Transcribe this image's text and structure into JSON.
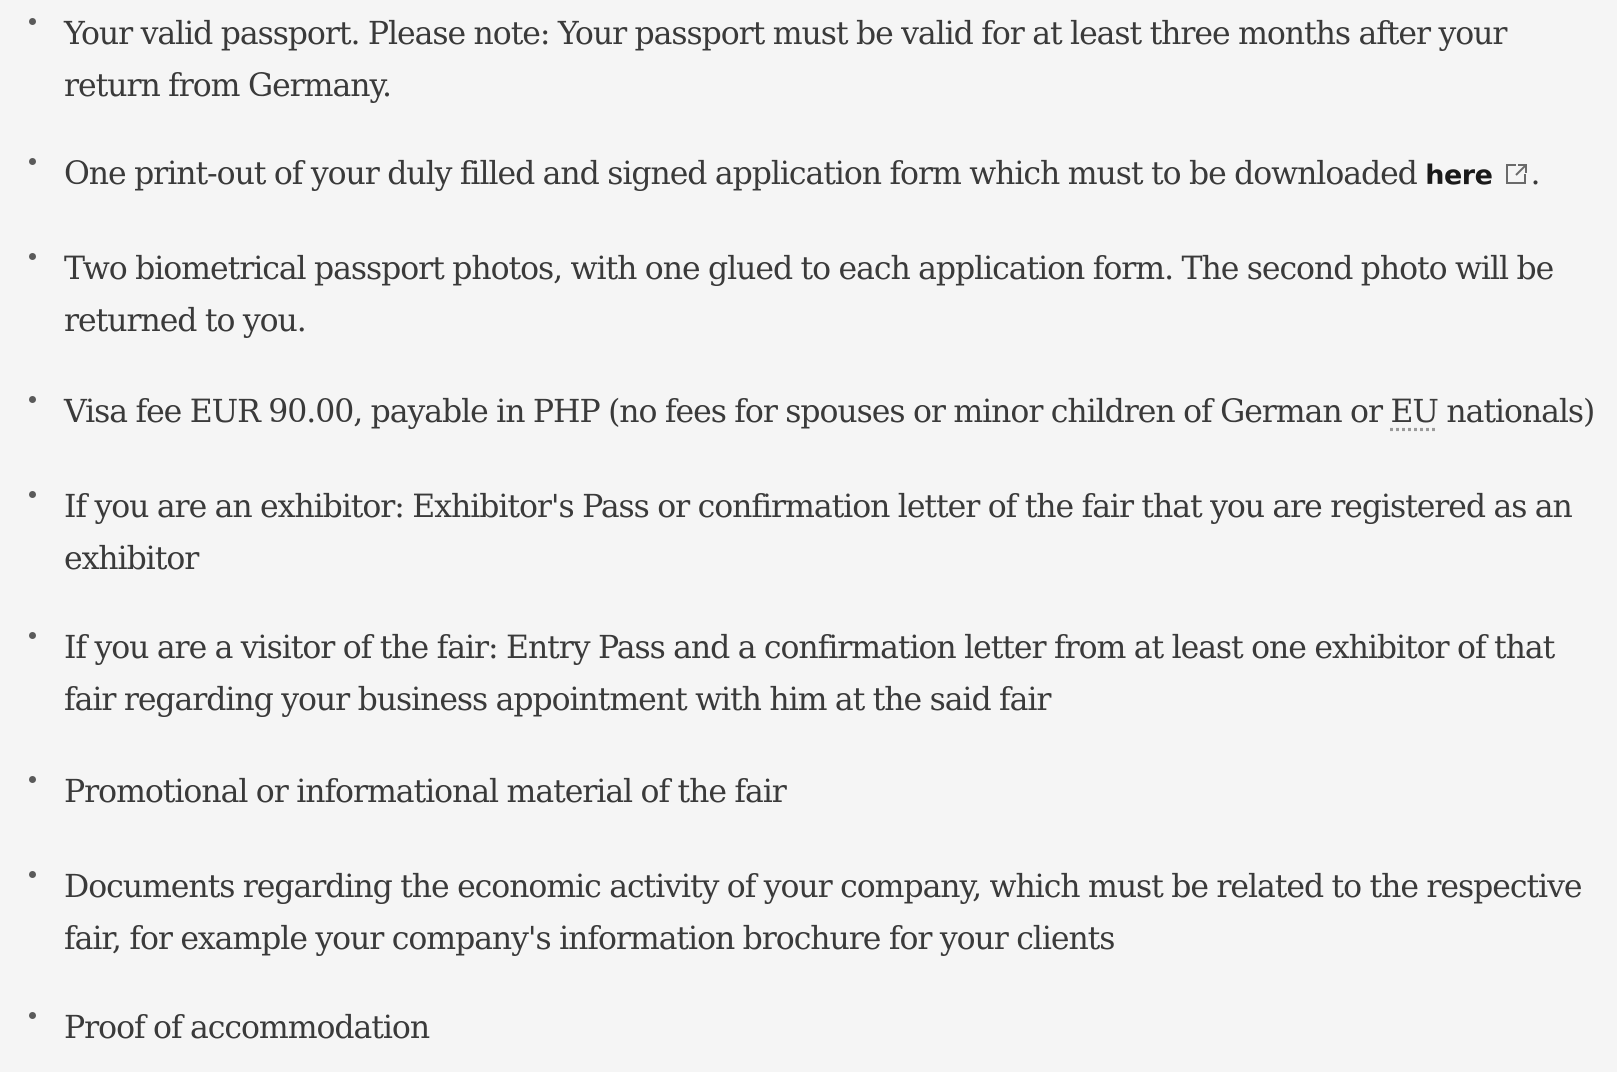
{
  "requirements": [
    {
      "text": "Your valid passport. Please note: Your passport must be valid for at least three months after your return from Germany."
    },
    {
      "text_before": "One print-out of your duly filled and signed application form which must to be downloaded ",
      "link_label": "here",
      "link_icon": "external-link-icon",
      "text_after": "."
    },
    {
      "text": "Two biometrical passport photos, with one glued to each application form. The second photo will be returned to you."
    },
    {
      "text_before": "Visa fee EUR 90.00, payable in PHP (no fees for spouses or minor children of German or ",
      "abbr": "EU",
      "text_after": " nationals)"
    },
    {
      "text": "If you are an exhibitor: Exhibitor's Pass or confirmation letter of the fair that you are registered as an exhibitor"
    },
    {
      "text": "If you are a visitor of the fair: Entry Pass and a confirmation letter from at least one exhibitor of that fair regarding your business appointment with him at the said fair"
    },
    {
      "text": "Promotional or informational material of the fair"
    },
    {
      "text": "Documents regarding the economic activity of your company, which must be related to the respective fair, for example your company's information brochure for your clients"
    },
    {
      "text": "Proof of accommodation"
    }
  ]
}
